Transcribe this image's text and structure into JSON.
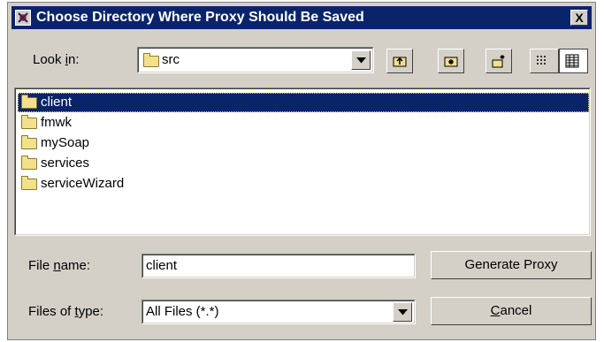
{
  "window": {
    "title": "Choose Directory Where Proxy Should Be Saved",
    "close_label": "X"
  },
  "look_in": {
    "label_pre": "Look ",
    "label_ul": "i",
    "label_post": "n:",
    "value": "src"
  },
  "toolbar": {
    "icons": [
      "up-one-level-icon",
      "home-folder-icon",
      "new-folder-icon",
      "list-view-icon",
      "details-view-icon"
    ]
  },
  "files": [
    {
      "name": "client",
      "selected": true
    },
    {
      "name": "fmwk",
      "selected": false
    },
    {
      "name": "mySoap",
      "selected": false
    },
    {
      "name": "services",
      "selected": false
    },
    {
      "name": "serviceWizard",
      "selected": false
    }
  ],
  "file_name": {
    "label_pre": "File ",
    "label_ul": "n",
    "label_post": "ame:",
    "value": "client"
  },
  "file_type": {
    "label_pre": "Files of ",
    "label_ul": "t",
    "label_post": "ype:",
    "value": "All Files (*.*)"
  },
  "buttons": {
    "generate_label": "Generate Proxy",
    "cancel_ul": "C",
    "cancel_post": "ancel"
  },
  "colors": {
    "title_bar": "#0a246a",
    "selection": "#0a246a",
    "face": "#d4d0c8"
  }
}
